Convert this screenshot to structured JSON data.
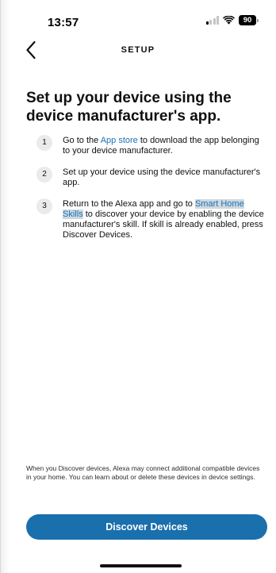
{
  "status_bar": {
    "time": "13:57",
    "battery_level": "90",
    "icons": [
      "cellular-signal-icon",
      "wifi-icon",
      "battery-icon"
    ]
  },
  "nav": {
    "title": "SETUP",
    "back_icon": "chevron-left-icon"
  },
  "page": {
    "title": "Set up your device using the device manufacturer's app.",
    "steps": [
      {
        "number": "1",
        "before": "Go to the ",
        "link": "App store",
        "after": " to download the app belonging to your device manufacturer."
      },
      {
        "number": "2",
        "text": "Set up your device using the device manufacturer's app."
      },
      {
        "number": "3",
        "before": "Return to the Alexa app and go to ",
        "link": "Smart Home Skills",
        "after": " to discover your device by enabling the device manufacturer's skill. If skill is already enabled, press Discover Devices."
      }
    ]
  },
  "footer": {
    "disclaimer": "When you Discover devices, Alexa may connect additional compatible devices in your home. You can learn about or delete these devices in device settings.",
    "discover_button": "Discover Devices"
  },
  "colors": {
    "accent": "#1a6fad",
    "link": "#1a73b8",
    "text": "#0f1111",
    "step_circle": "#ebebeb",
    "link_highlight": "#cfd8df"
  }
}
